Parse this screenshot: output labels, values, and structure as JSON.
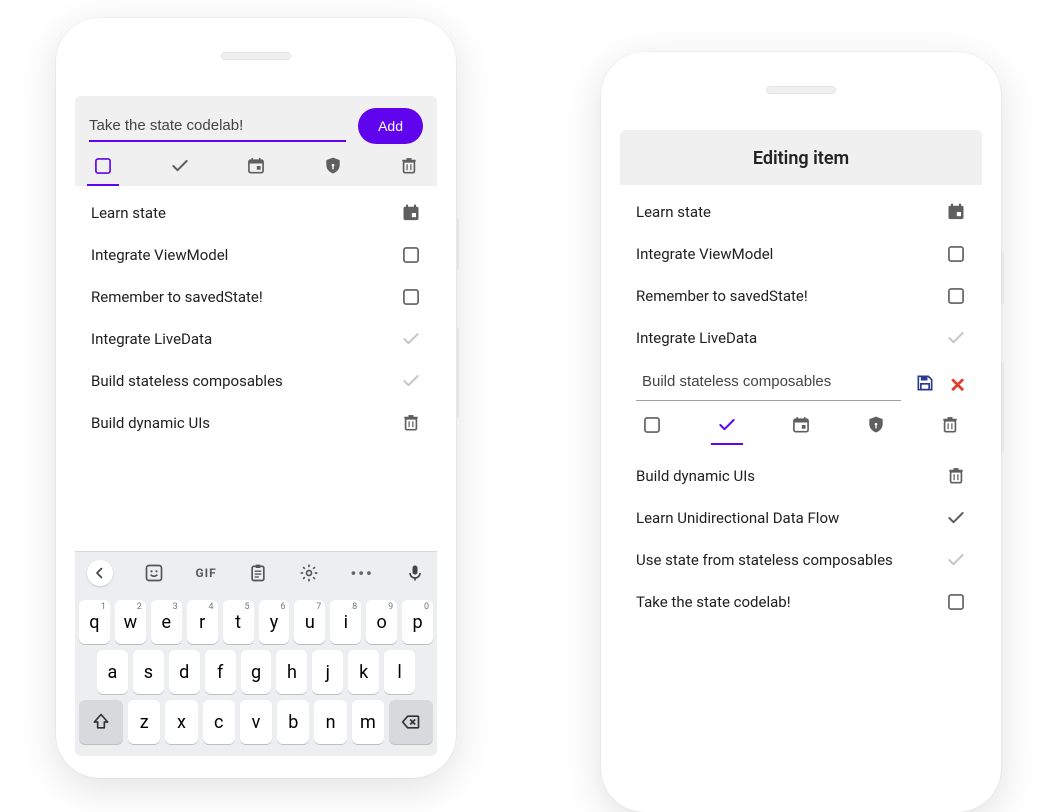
{
  "left": {
    "input_value": "Take the state codelab!",
    "add_label": "Add",
    "tabs": [
      "square",
      "check",
      "event",
      "shield",
      "trash"
    ],
    "selected_tab": 0,
    "items": [
      {
        "label": "Learn state",
        "trail": "event-filled"
      },
      {
        "label": "Integrate ViewModel",
        "trail": "square"
      },
      {
        "label": "Remember to savedState!",
        "trail": "square"
      },
      {
        "label": "Integrate LiveData",
        "trail": "check-dim"
      },
      {
        "label": "Build stateless composables",
        "trail": "check-dim"
      },
      {
        "label": "Build dynamic UIs",
        "trail": "trash"
      }
    ],
    "keyboard": {
      "top_icons": [
        "chevron-left",
        "sticker",
        "gif",
        "clipboard",
        "settings",
        "dots",
        "mic"
      ],
      "row1": [
        {
          "k": "q",
          "s": "1"
        },
        {
          "k": "w",
          "s": "2"
        },
        {
          "k": "e",
          "s": "3"
        },
        {
          "k": "r",
          "s": "4"
        },
        {
          "k": "t",
          "s": "5"
        },
        {
          "k": "y",
          "s": "6"
        },
        {
          "k": "u",
          "s": "7"
        },
        {
          "k": "i",
          "s": "8"
        },
        {
          "k": "o",
          "s": "9"
        },
        {
          "k": "p",
          "s": "0"
        }
      ],
      "row2": [
        {
          "k": "a"
        },
        {
          "k": "s"
        },
        {
          "k": "d"
        },
        {
          "k": "f"
        },
        {
          "k": "g"
        },
        {
          "k": "h"
        },
        {
          "k": "j"
        },
        {
          "k": "k"
        },
        {
          "k": "l"
        }
      ],
      "row3_mod_left": "shift",
      "row3": [
        {
          "k": "z"
        },
        {
          "k": "x"
        },
        {
          "k": "c"
        },
        {
          "k": "v"
        },
        {
          "k": "b"
        },
        {
          "k": "n"
        },
        {
          "k": "m"
        }
      ],
      "row3_mod_right": "backspace"
    }
  },
  "right": {
    "header": "Editing item",
    "items_top": [
      {
        "label": "Learn state",
        "trail": "event-filled"
      },
      {
        "label": "Integrate ViewModel",
        "trail": "square"
      },
      {
        "label": "Remember to savedState!",
        "trail": "square"
      },
      {
        "label": "Integrate LiveData",
        "trail": "check-dim"
      }
    ],
    "edit_value": "Build stateless composables",
    "tabs": [
      "square",
      "check",
      "event",
      "shield",
      "trash"
    ],
    "selected_tab": 1,
    "items_bottom": [
      {
        "label": "Build dynamic UIs",
        "trail": "trash"
      },
      {
        "label": "Learn Unidirectional Data Flow",
        "trail": "check"
      },
      {
        "label": "Use state from stateless composables",
        "trail": "check-dim"
      },
      {
        "label": "Take the state codelab!",
        "trail": "square"
      }
    ]
  }
}
